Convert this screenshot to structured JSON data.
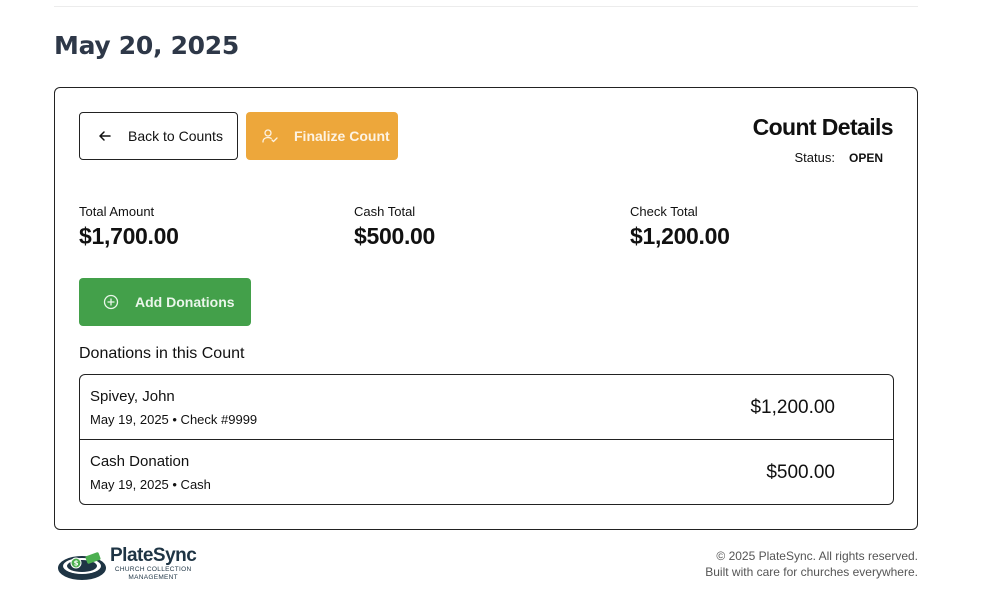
{
  "page": {
    "title": "May 20, 2025"
  },
  "actions": {
    "back_label": "Back to Counts",
    "finalize_label": "Finalize Count",
    "add_donations_label": "Add Donations"
  },
  "details": {
    "title": "Count Details",
    "status_label": "Status:",
    "status_value": "OPEN"
  },
  "totals": [
    {
      "label": "Total Amount",
      "value": "$1,700.00"
    },
    {
      "label": "Cash Total",
      "value": "$500.00"
    },
    {
      "label": "Check Total",
      "value": "$1,200.00"
    }
  ],
  "donations": {
    "section_title": "Donations in this Count",
    "items": [
      {
        "name": "Spivey, John",
        "meta": "May 19, 2025 • Check #9999",
        "amount": "$1,200.00"
      },
      {
        "name": "Cash Donation",
        "meta": "May 19, 2025 • Cash",
        "amount": "$500.00"
      }
    ]
  },
  "footer": {
    "logo_name": "PlateSync",
    "logo_tagline_1": "CHURCH COLLECTION",
    "logo_tagline_2": "MANAGEMENT",
    "copyright": "© 2025 PlateSync. All rights reserved.",
    "tagline": "Built with care for churches everywhere."
  },
  "colors": {
    "finalize": "#eda73b",
    "add": "#43a04a",
    "title": "#2e3848",
    "logo": "#1e3444"
  },
  "icons": {
    "back": "arrow-left-icon",
    "finalize": "user-check-icon",
    "add": "plus-circle-icon"
  }
}
